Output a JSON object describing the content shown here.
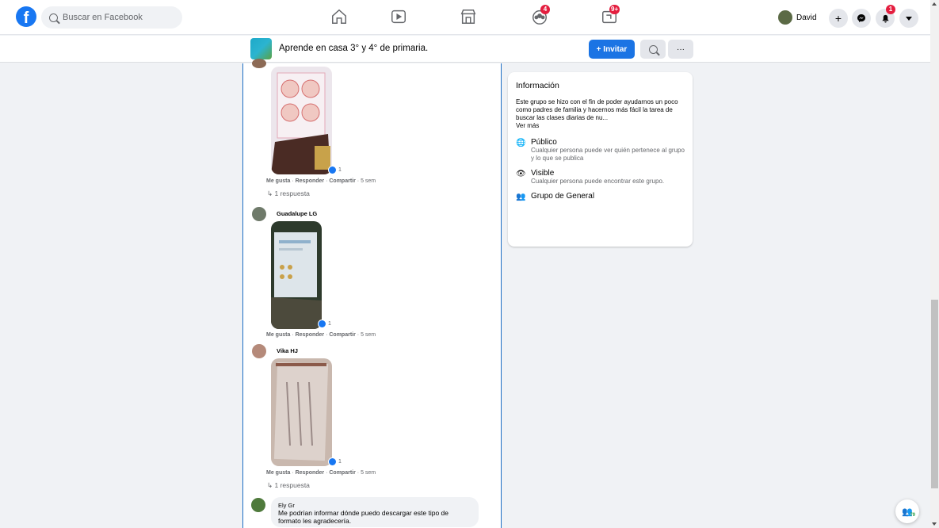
{
  "topnav": {
    "logo": "f",
    "search_placeholder": "Buscar en Facebook",
    "groups_badge": "4",
    "gaming_badge": "9+",
    "profile_name": "David",
    "notif_badge": "1"
  },
  "group_header": {
    "name": "Aprende en casa 3° y 4° de primaria.",
    "invite_label": "+ Invitar",
    "more_label": "···"
  },
  "feed": {
    "comment1": {
      "reactions": "1",
      "actions": {
        "like": "Me gusta",
        "reply": "Responder",
        "share": "Compartir",
        "time": "5 sem"
      },
      "replies": "1 respuesta"
    },
    "comment2": {
      "author": "Guadalupe LG",
      "reactions": "1",
      "actions": {
        "like": "Me gusta",
        "reply": "Responder",
        "share": "Compartir",
        "time": "5 sem"
      }
    },
    "comment3": {
      "author": "Vika HJ",
      "reactions": "1",
      "actions": {
        "like": "Me gusta",
        "reply": "Responder",
        "share": "Compartir",
        "time": "5 sem"
      },
      "replies": "1 respuesta"
    },
    "comment4": {
      "author": "Ely Gr",
      "text": "Me podrían informar dónde puedo descargar este tipo de formato les agradecería."
    }
  },
  "info": {
    "title": "Información",
    "description": "Este grupo se hizo con el fin de poder ayudarnos un poco como padres de familia y hacernos más fácil la tarea de buscar las clases diarias de nu...",
    "see_more": "Ver más",
    "public_title": "Público",
    "public_desc": "Cualquier persona puede ver quién pertenece al grupo y lo que se publica",
    "visible_title": "Visible",
    "visible_desc": "Cualquier persona puede encontrar este grupo.",
    "type": "Grupo de General"
  },
  "contacts_count": "79",
  "colors": {
    "accent": "#1877f2",
    "badge": "#e41e3f"
  }
}
